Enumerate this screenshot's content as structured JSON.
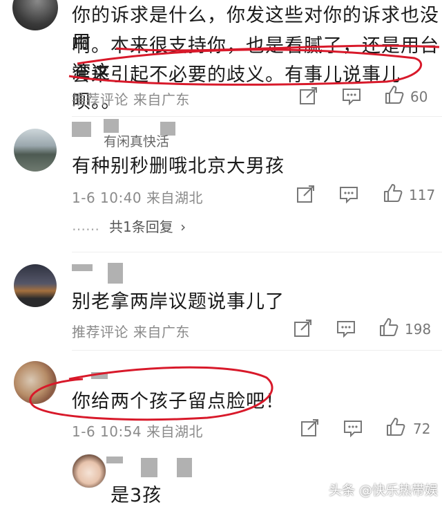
{
  "comments": [
    {
      "text_lines": [
        "你的诉求是什么，你发这些对你的诉求也没用",
        "啊。本来很支持你，也是看腻了，还是用台湾这",
        "套来引起不必要的歧义。有事儿说事儿呗。。"
      ],
      "meta": "推荐评论  来自广东",
      "likes": "60"
    },
    {
      "username": "有闲真快活",
      "text": "有种别秒删哦北京大男孩",
      "meta": "1-6 10:40  来自湖北",
      "likes": "117",
      "replies_label": "共1条回复",
      "replies_dots": "……"
    },
    {
      "text": "别老拿两岸议题说事儿了",
      "meta": "推荐评论  来自广东",
      "likes": "198"
    },
    {
      "text": "你给两个孩子留点脸吧！",
      "meta": "1-6 10:54  来自湖北",
      "likes": "72"
    },
    {
      "text": "是3孩"
    }
  ],
  "watermark": "头条 @快乐热带娱",
  "icons": {
    "share": "share-icon",
    "comment": "comment-icon",
    "like": "thumbs-up-icon"
  },
  "colors": {
    "annotation_red": "#d8192a"
  }
}
